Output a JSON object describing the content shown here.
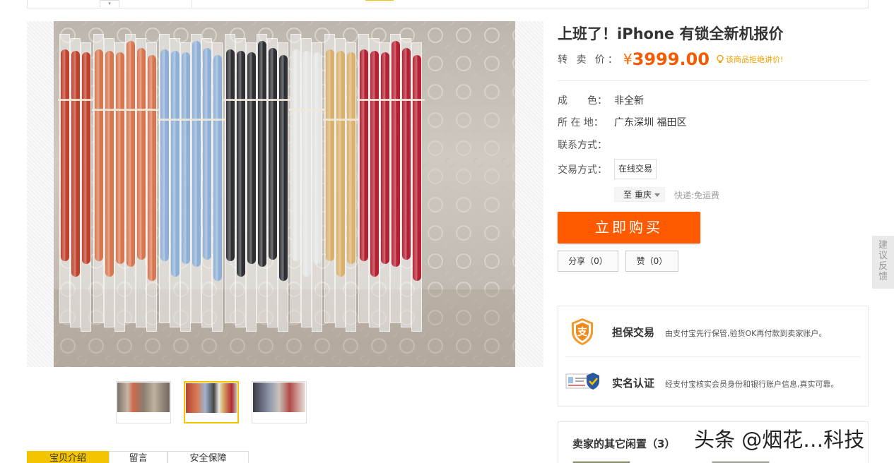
{
  "header": {
    "dropdown_arrow": "▾"
  },
  "gallery": {
    "thumbnails": [
      {
        "label": "thumbnail-1",
        "active": false
      },
      {
        "label": "thumbnail-2",
        "active": true
      },
      {
        "label": "thumbnail-3",
        "active": false
      }
    ]
  },
  "product": {
    "title": "上班了！iPhone 有锁全新机报价",
    "price_label": "转 卖 价：",
    "currency": "¥",
    "price": "3999.00",
    "price_note": "该商品拒绝讲价!",
    "details": [
      {
        "label": "成　　色：",
        "value": "非全新"
      },
      {
        "label": "所 在 地：",
        "value": "广东深圳 福田区"
      },
      {
        "label": "联系方式：",
        "value": ""
      },
      {
        "label": "交易方式：",
        "value": ""
      }
    ],
    "trade_method": "在线交易",
    "shipping_to": "至 重庆",
    "shipping_note": "快递:免运费",
    "buy_button": "立即购买",
    "share_button": "分享（0）",
    "like_button": "赞（0）"
  },
  "security": {
    "guarantee_title": "担保交易",
    "guarantee_desc": "由支付宝先行保管,验货OK再付款到卖家账户。",
    "guarantee_icon_char": "支",
    "realname_title": "实名认证",
    "realname_desc": "经支付宝核实会员身份和银行账户信息,真实可靠。"
  },
  "seller_other": {
    "title": "卖家的其它闲置（3）"
  },
  "feedback": {
    "chars": [
      "建",
      "议",
      "反",
      "馈"
    ]
  },
  "bottom_tabs": [
    "宝贝介绍",
    "留言",
    "安全保障"
  ],
  "watermark": "头条 @烟花…科技",
  "colors": {
    "accent": "#ff5a00",
    "price": "#f55a00",
    "tab_active": "#f5c400"
  }
}
